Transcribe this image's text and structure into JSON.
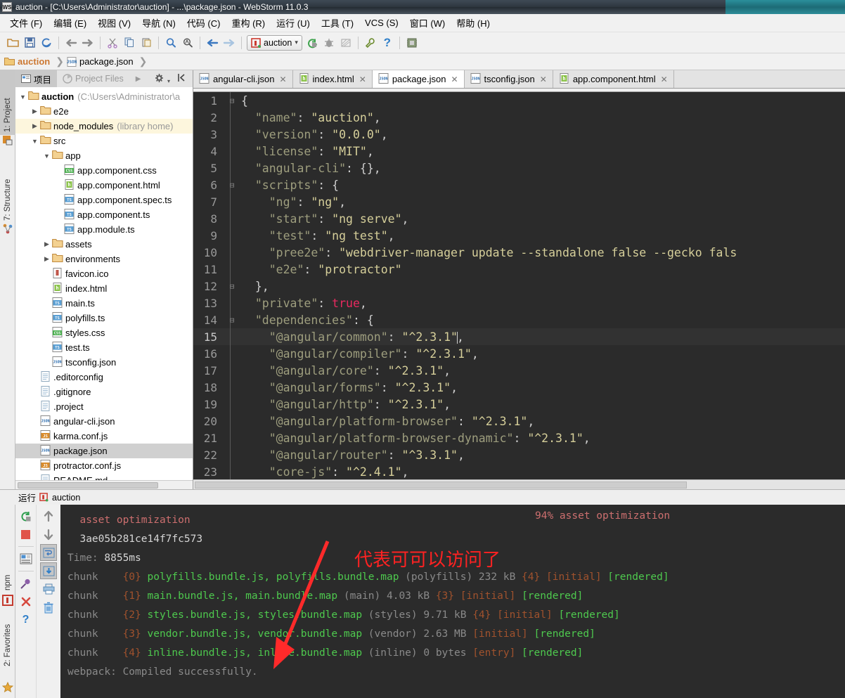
{
  "window": {
    "title": "auction - [C:\\Users\\Administrator\\auction] - ...\\package.json - WebStorm 11.0.3",
    "app_icon": "WS"
  },
  "menubar": [
    {
      "label": "文件 (F)"
    },
    {
      "label": "编辑 (E)"
    },
    {
      "label": "视图 (V)"
    },
    {
      "label": "导航 (N)"
    },
    {
      "label": "代码 (C)"
    },
    {
      "label": "重构 (R)"
    },
    {
      "label": "运行 (U)"
    },
    {
      "label": "工具 (T)"
    },
    {
      "label": "VCS (S)"
    },
    {
      "label": "窗口 (W)"
    },
    {
      "label": "帮助 (H)"
    }
  ],
  "toolbar": {
    "run_config_label": "auction",
    "dropdown_glyph": "▾"
  },
  "breadcrumb": {
    "project": "auction",
    "file": "package.json",
    "separator": "❯"
  },
  "left_tool_tabs": [
    {
      "label": "1: Project",
      "active": true
    },
    {
      "label": "7: Structure",
      "active": false
    }
  ],
  "left_bottom_tabs": [
    {
      "label": "npm"
    },
    {
      "label": "2: Favorites"
    }
  ],
  "project_panel": {
    "tabs": [
      {
        "label": "项目",
        "selected": true
      },
      {
        "label": "Project Files",
        "selected": false
      }
    ],
    "tree": [
      {
        "indent": 0,
        "arrow": "▼",
        "icon": "folder",
        "label": "auction",
        "bold": true,
        "note": "(C:\\Users\\Administrator\\a",
        "highlight": false,
        "selected": false
      },
      {
        "indent": 1,
        "arrow": "▶",
        "icon": "folder",
        "label": "e2e",
        "bold": false,
        "note": "",
        "highlight": false,
        "selected": false
      },
      {
        "indent": 1,
        "arrow": "▶",
        "icon": "folder",
        "label": "node_modules",
        "bold": false,
        "note": "(library home)",
        "highlight": true,
        "selected": false
      },
      {
        "indent": 1,
        "arrow": "▼",
        "icon": "folder",
        "label": "src",
        "bold": false,
        "note": "",
        "highlight": false,
        "selected": false
      },
      {
        "indent": 2,
        "arrow": "▼",
        "icon": "folder",
        "label": "app",
        "bold": false,
        "note": "",
        "highlight": false,
        "selected": false
      },
      {
        "indent": 3,
        "arrow": "",
        "icon": "css",
        "label": "app.component.css",
        "bold": false,
        "note": "",
        "highlight": false,
        "selected": false
      },
      {
        "indent": 3,
        "arrow": "",
        "icon": "html",
        "label": "app.component.html",
        "bold": false,
        "note": "",
        "highlight": false,
        "selected": false
      },
      {
        "indent": 3,
        "arrow": "",
        "icon": "ts",
        "label": "app.component.spec.ts",
        "bold": false,
        "note": "",
        "highlight": false,
        "selected": false
      },
      {
        "indent": 3,
        "arrow": "",
        "icon": "ts",
        "label": "app.component.ts",
        "bold": false,
        "note": "",
        "highlight": false,
        "selected": false
      },
      {
        "indent": 3,
        "arrow": "",
        "icon": "ts",
        "label": "app.module.ts",
        "bold": false,
        "note": "",
        "highlight": false,
        "selected": false
      },
      {
        "indent": 2,
        "arrow": "▶",
        "icon": "folder",
        "label": "assets",
        "bold": false,
        "note": "",
        "highlight": false,
        "selected": false
      },
      {
        "indent": 2,
        "arrow": "▶",
        "icon": "folder",
        "label": "environments",
        "bold": false,
        "note": "",
        "highlight": false,
        "selected": false
      },
      {
        "indent": 2,
        "arrow": "",
        "icon": "ico",
        "label": "favicon.ico",
        "bold": false,
        "note": "",
        "highlight": false,
        "selected": false
      },
      {
        "indent": 2,
        "arrow": "",
        "icon": "html",
        "label": "index.html",
        "bold": false,
        "note": "",
        "highlight": false,
        "selected": false
      },
      {
        "indent": 2,
        "arrow": "",
        "icon": "ts",
        "label": "main.ts",
        "bold": false,
        "note": "",
        "highlight": false,
        "selected": false
      },
      {
        "indent": 2,
        "arrow": "",
        "icon": "ts",
        "label": "polyfills.ts",
        "bold": false,
        "note": "",
        "highlight": false,
        "selected": false
      },
      {
        "indent": 2,
        "arrow": "",
        "icon": "css",
        "label": "styles.css",
        "bold": false,
        "note": "",
        "highlight": false,
        "selected": false
      },
      {
        "indent": 2,
        "arrow": "",
        "icon": "ts",
        "label": "test.ts",
        "bold": false,
        "note": "",
        "highlight": false,
        "selected": false
      },
      {
        "indent": 2,
        "arrow": "",
        "icon": "json",
        "label": "tsconfig.json",
        "bold": false,
        "note": "",
        "highlight": false,
        "selected": false
      },
      {
        "indent": 1,
        "arrow": "",
        "icon": "file",
        "label": ".editorconfig",
        "bold": false,
        "note": "",
        "highlight": false,
        "selected": false
      },
      {
        "indent": 1,
        "arrow": "",
        "icon": "file",
        "label": ".gitignore",
        "bold": false,
        "note": "",
        "highlight": false,
        "selected": false
      },
      {
        "indent": 1,
        "arrow": "",
        "icon": "file",
        "label": ".project",
        "bold": false,
        "note": "",
        "highlight": false,
        "selected": false
      },
      {
        "indent": 1,
        "arrow": "",
        "icon": "json",
        "label": "angular-cli.json",
        "bold": false,
        "note": "",
        "highlight": false,
        "selected": false
      },
      {
        "indent": 1,
        "arrow": "",
        "icon": "js",
        "label": "karma.conf.js",
        "bold": false,
        "note": "",
        "highlight": false,
        "selected": false
      },
      {
        "indent": 1,
        "arrow": "",
        "icon": "json",
        "label": "package.json",
        "bold": false,
        "note": "",
        "highlight": false,
        "selected": true
      },
      {
        "indent": 1,
        "arrow": "",
        "icon": "js",
        "label": "protractor.conf.js",
        "bold": false,
        "note": "",
        "highlight": false,
        "selected": false
      },
      {
        "indent": 1,
        "arrow": "",
        "icon": "file",
        "label": "README.md",
        "bold": false,
        "note": "",
        "highlight": false,
        "selected": false
      }
    ]
  },
  "editor": {
    "tabs": [
      {
        "label": "angular-cli.json",
        "icon": "json",
        "active": false
      },
      {
        "label": "index.html",
        "icon": "html",
        "active": false
      },
      {
        "label": "package.json",
        "icon": "json",
        "active": true
      },
      {
        "label": "tsconfig.json",
        "icon": "json",
        "active": false
      },
      {
        "label": "app.component.html",
        "icon": "html",
        "active": false
      }
    ],
    "close_glyph": "✕",
    "current_line": 15,
    "lines": [
      {
        "n": 1,
        "fold": "⊟",
        "indent": 0,
        "text": "{",
        "type": "punct"
      },
      {
        "n": 2,
        "fold": "",
        "indent": 1,
        "key": "\"name\"",
        "value": "\"auction\"",
        "tail": ","
      },
      {
        "n": 3,
        "fold": "",
        "indent": 1,
        "key": "\"version\"",
        "value": "\"0.0.0\"",
        "tail": ","
      },
      {
        "n": 4,
        "fold": "",
        "indent": 1,
        "key": "\"license\"",
        "value": "\"MIT\"",
        "tail": ","
      },
      {
        "n": 5,
        "fold": "",
        "indent": 1,
        "key": "\"angular-cli\"",
        "value": "{}",
        "tail": ",",
        "vtype": "punct"
      },
      {
        "n": 6,
        "fold": "⊟",
        "indent": 1,
        "key": "\"scripts\"",
        "value": "{",
        "tail": "",
        "vtype": "punct"
      },
      {
        "n": 7,
        "fold": "",
        "indent": 2,
        "key": "\"ng\"",
        "value": "\"ng\"",
        "tail": ","
      },
      {
        "n": 8,
        "fold": "",
        "indent": 2,
        "key": "\"start\"",
        "value": "\"ng serve\"",
        "tail": ","
      },
      {
        "n": 9,
        "fold": "",
        "indent": 2,
        "key": "\"test\"",
        "value": "\"ng test\"",
        "tail": ","
      },
      {
        "n": 10,
        "fold": "",
        "indent": 2,
        "key": "\"pree2e\"",
        "value": "\"webdriver-manager update --standalone false --gecko fals",
        "tail": ""
      },
      {
        "n": 11,
        "fold": "",
        "indent": 2,
        "key": "\"e2e\"",
        "value": "\"protractor\"",
        "tail": ""
      },
      {
        "n": 12,
        "fold": "⊟",
        "indent": 1,
        "text": "},",
        "type": "punct"
      },
      {
        "n": 13,
        "fold": "",
        "indent": 1,
        "key": "\"private\"",
        "value": "true",
        "tail": ",",
        "vtype": "bool"
      },
      {
        "n": 14,
        "fold": "⊟",
        "indent": 1,
        "key": "\"dependencies\"",
        "value": "{",
        "tail": "",
        "vtype": "punct"
      },
      {
        "n": 15,
        "fold": "",
        "indent": 2,
        "key": "\"@angular/common\"",
        "value": "\"^2.3.1\"",
        "tail": ",",
        "caret": true
      },
      {
        "n": 16,
        "fold": "",
        "indent": 2,
        "key": "\"@angular/compiler\"",
        "value": "\"^2.3.1\"",
        "tail": ","
      },
      {
        "n": 17,
        "fold": "",
        "indent": 2,
        "key": "\"@angular/core\"",
        "value": "\"^2.3.1\"",
        "tail": ","
      },
      {
        "n": 18,
        "fold": "",
        "indent": 2,
        "key": "\"@angular/forms\"",
        "value": "\"^2.3.1\"",
        "tail": ","
      },
      {
        "n": 19,
        "fold": "",
        "indent": 2,
        "key": "\"@angular/http\"",
        "value": "\"^2.3.1\"",
        "tail": ","
      },
      {
        "n": 20,
        "fold": "",
        "indent": 2,
        "key": "\"@angular/platform-browser\"",
        "value": "\"^2.3.1\"",
        "tail": ","
      },
      {
        "n": 21,
        "fold": "",
        "indent": 2,
        "key": "\"@angular/platform-browser-dynamic\"",
        "value": "\"^2.3.1\"",
        "tail": ","
      },
      {
        "n": 22,
        "fold": "",
        "indent": 2,
        "key": "\"@angular/router\"",
        "value": "\"^3.3.1\"",
        "tail": ","
      },
      {
        "n": 23,
        "fold": "",
        "indent": 2,
        "key": "\"core-js\"",
        "value": "\"^2.4.1\"",
        "tail": ","
      }
    ]
  },
  "run_panel": {
    "header_label": "运行",
    "header_config": "auction",
    "progress_text": "94% asset optimization",
    "annotation": "代表可可以访问了",
    "lines": [
      {
        "type": "plain",
        "segs": [
          {
            "t": "  asset optimization",
            "c": "pnk"
          }
        ]
      },
      {
        "type": "plain",
        "segs": [
          {
            "t": "  3ae05b281ce14f7fc573",
            "c": "wht"
          }
        ]
      },
      {
        "type": "plain",
        "segs": [
          {
            "t": "Time: ",
            "c": "dim"
          },
          {
            "t": "8855ms",
            "c": "wht"
          }
        ]
      },
      {
        "type": "chunk",
        "segs": [
          {
            "t": "chunk    ",
            "c": "dim"
          },
          {
            "t": "{0}",
            "c": "org"
          },
          {
            "t": " polyfills.bundle.js, polyfills.bundle.map",
            "c": "g"
          },
          {
            "t": " (polyfills) 232 kB ",
            "c": "dim"
          },
          {
            "t": "{4}",
            "c": "org"
          },
          {
            "t": " [initial]",
            "c": "org"
          },
          {
            "t": " [rendered]",
            "c": "g"
          }
        ]
      },
      {
        "type": "chunk",
        "segs": [
          {
            "t": "chunk    ",
            "c": "dim"
          },
          {
            "t": "{1}",
            "c": "org"
          },
          {
            "t": " main.bundle.js, main.bundle.map",
            "c": "g"
          },
          {
            "t": " (main) 4.03 kB ",
            "c": "dim"
          },
          {
            "t": "{3}",
            "c": "org"
          },
          {
            "t": " [initial]",
            "c": "org"
          },
          {
            "t": " [rendered]",
            "c": "g"
          }
        ]
      },
      {
        "type": "chunk",
        "segs": [
          {
            "t": "chunk    ",
            "c": "dim"
          },
          {
            "t": "{2}",
            "c": "org"
          },
          {
            "t": " styles.bundle.js, styles.bundle.map",
            "c": "g"
          },
          {
            "t": " (styles) 9.71 kB ",
            "c": "dim"
          },
          {
            "t": "{4}",
            "c": "org"
          },
          {
            "t": " [initial]",
            "c": "org"
          },
          {
            "t": " [rendered]",
            "c": "g"
          }
        ]
      },
      {
        "type": "chunk",
        "segs": [
          {
            "t": "chunk    ",
            "c": "dim"
          },
          {
            "t": "{3}",
            "c": "org"
          },
          {
            "t": " vendor.bundle.js, vendor.bundle.map",
            "c": "g"
          },
          {
            "t": " (vendor) 2.63 MB ",
            "c": "dim"
          },
          {
            "t": "[initial]",
            "c": "org"
          },
          {
            "t": " [rendered]",
            "c": "g"
          }
        ]
      },
      {
        "type": "chunk",
        "segs": [
          {
            "t": "chunk    ",
            "c": "dim"
          },
          {
            "t": "{4}",
            "c": "org"
          },
          {
            "t": " inline.bundle.js, inline.bundle.map",
            "c": "g"
          },
          {
            "t": " (inline) 0 bytes ",
            "c": "dim"
          },
          {
            "t": "[entry]",
            "c": "org"
          },
          {
            "t": " [rendered]",
            "c": "g"
          }
        ]
      },
      {
        "type": "plain",
        "segs": [
          {
            "t": "webpack: Compiled successfully.",
            "c": "dim"
          }
        ]
      }
    ]
  },
  "colors": {
    "editor_bg": "#2b2b2b",
    "current_line_bg": "#323232",
    "string": "#d6cf9a",
    "key": "#9e9e7e",
    "bool": "#e8295f",
    "console_green": "#4ec94e",
    "console_orange": "#a0522d",
    "annotation_red": "#ff2222",
    "accent_teal": "#2b8f9b"
  }
}
